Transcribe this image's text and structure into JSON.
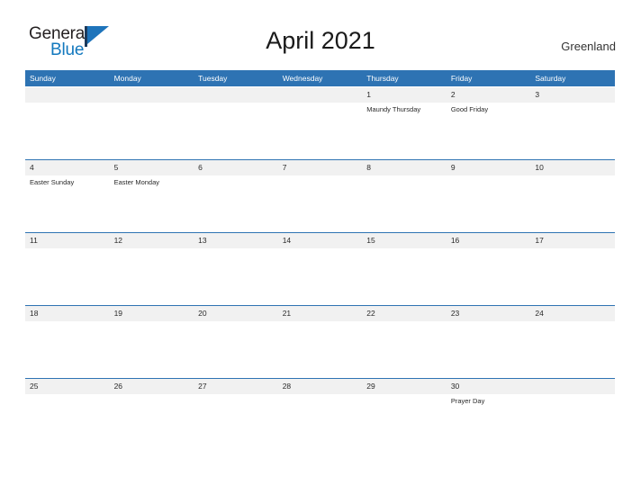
{
  "brand": {
    "name_part1": "General",
    "name_part2": "Blue",
    "color_dark": "#231f20",
    "color_blue": "#1278be"
  },
  "header": {
    "title": "April 2021",
    "locale": "Greenland"
  },
  "calendar": {
    "accent_color": "#2e73b3",
    "row_shade_color": "#f1f1f1",
    "weekdays": [
      "Sunday",
      "Monday",
      "Tuesday",
      "Wednesday",
      "Thursday",
      "Friday",
      "Saturday"
    ],
    "weeks": [
      {
        "days": [
          {
            "number": "",
            "event": ""
          },
          {
            "number": "",
            "event": ""
          },
          {
            "number": "",
            "event": ""
          },
          {
            "number": "",
            "event": ""
          },
          {
            "number": "1",
            "event": "Maundy Thursday"
          },
          {
            "number": "2",
            "event": "Good Friday"
          },
          {
            "number": "3",
            "event": ""
          }
        ]
      },
      {
        "days": [
          {
            "number": "4",
            "event": "Easter Sunday"
          },
          {
            "number": "5",
            "event": "Easter Monday"
          },
          {
            "number": "6",
            "event": ""
          },
          {
            "number": "7",
            "event": ""
          },
          {
            "number": "8",
            "event": ""
          },
          {
            "number": "9",
            "event": ""
          },
          {
            "number": "10",
            "event": ""
          }
        ]
      },
      {
        "days": [
          {
            "number": "11",
            "event": ""
          },
          {
            "number": "12",
            "event": ""
          },
          {
            "number": "13",
            "event": ""
          },
          {
            "number": "14",
            "event": ""
          },
          {
            "number": "15",
            "event": ""
          },
          {
            "number": "16",
            "event": ""
          },
          {
            "number": "17",
            "event": ""
          }
        ]
      },
      {
        "days": [
          {
            "number": "18",
            "event": ""
          },
          {
            "number": "19",
            "event": ""
          },
          {
            "number": "20",
            "event": ""
          },
          {
            "number": "21",
            "event": ""
          },
          {
            "number": "22",
            "event": ""
          },
          {
            "number": "23",
            "event": ""
          },
          {
            "number": "24",
            "event": ""
          }
        ]
      },
      {
        "days": [
          {
            "number": "25",
            "event": ""
          },
          {
            "number": "26",
            "event": ""
          },
          {
            "number": "27",
            "event": ""
          },
          {
            "number": "28",
            "event": ""
          },
          {
            "number": "29",
            "event": ""
          },
          {
            "number": "30",
            "event": "Prayer Day"
          },
          {
            "number": "",
            "event": ""
          }
        ]
      }
    ]
  }
}
